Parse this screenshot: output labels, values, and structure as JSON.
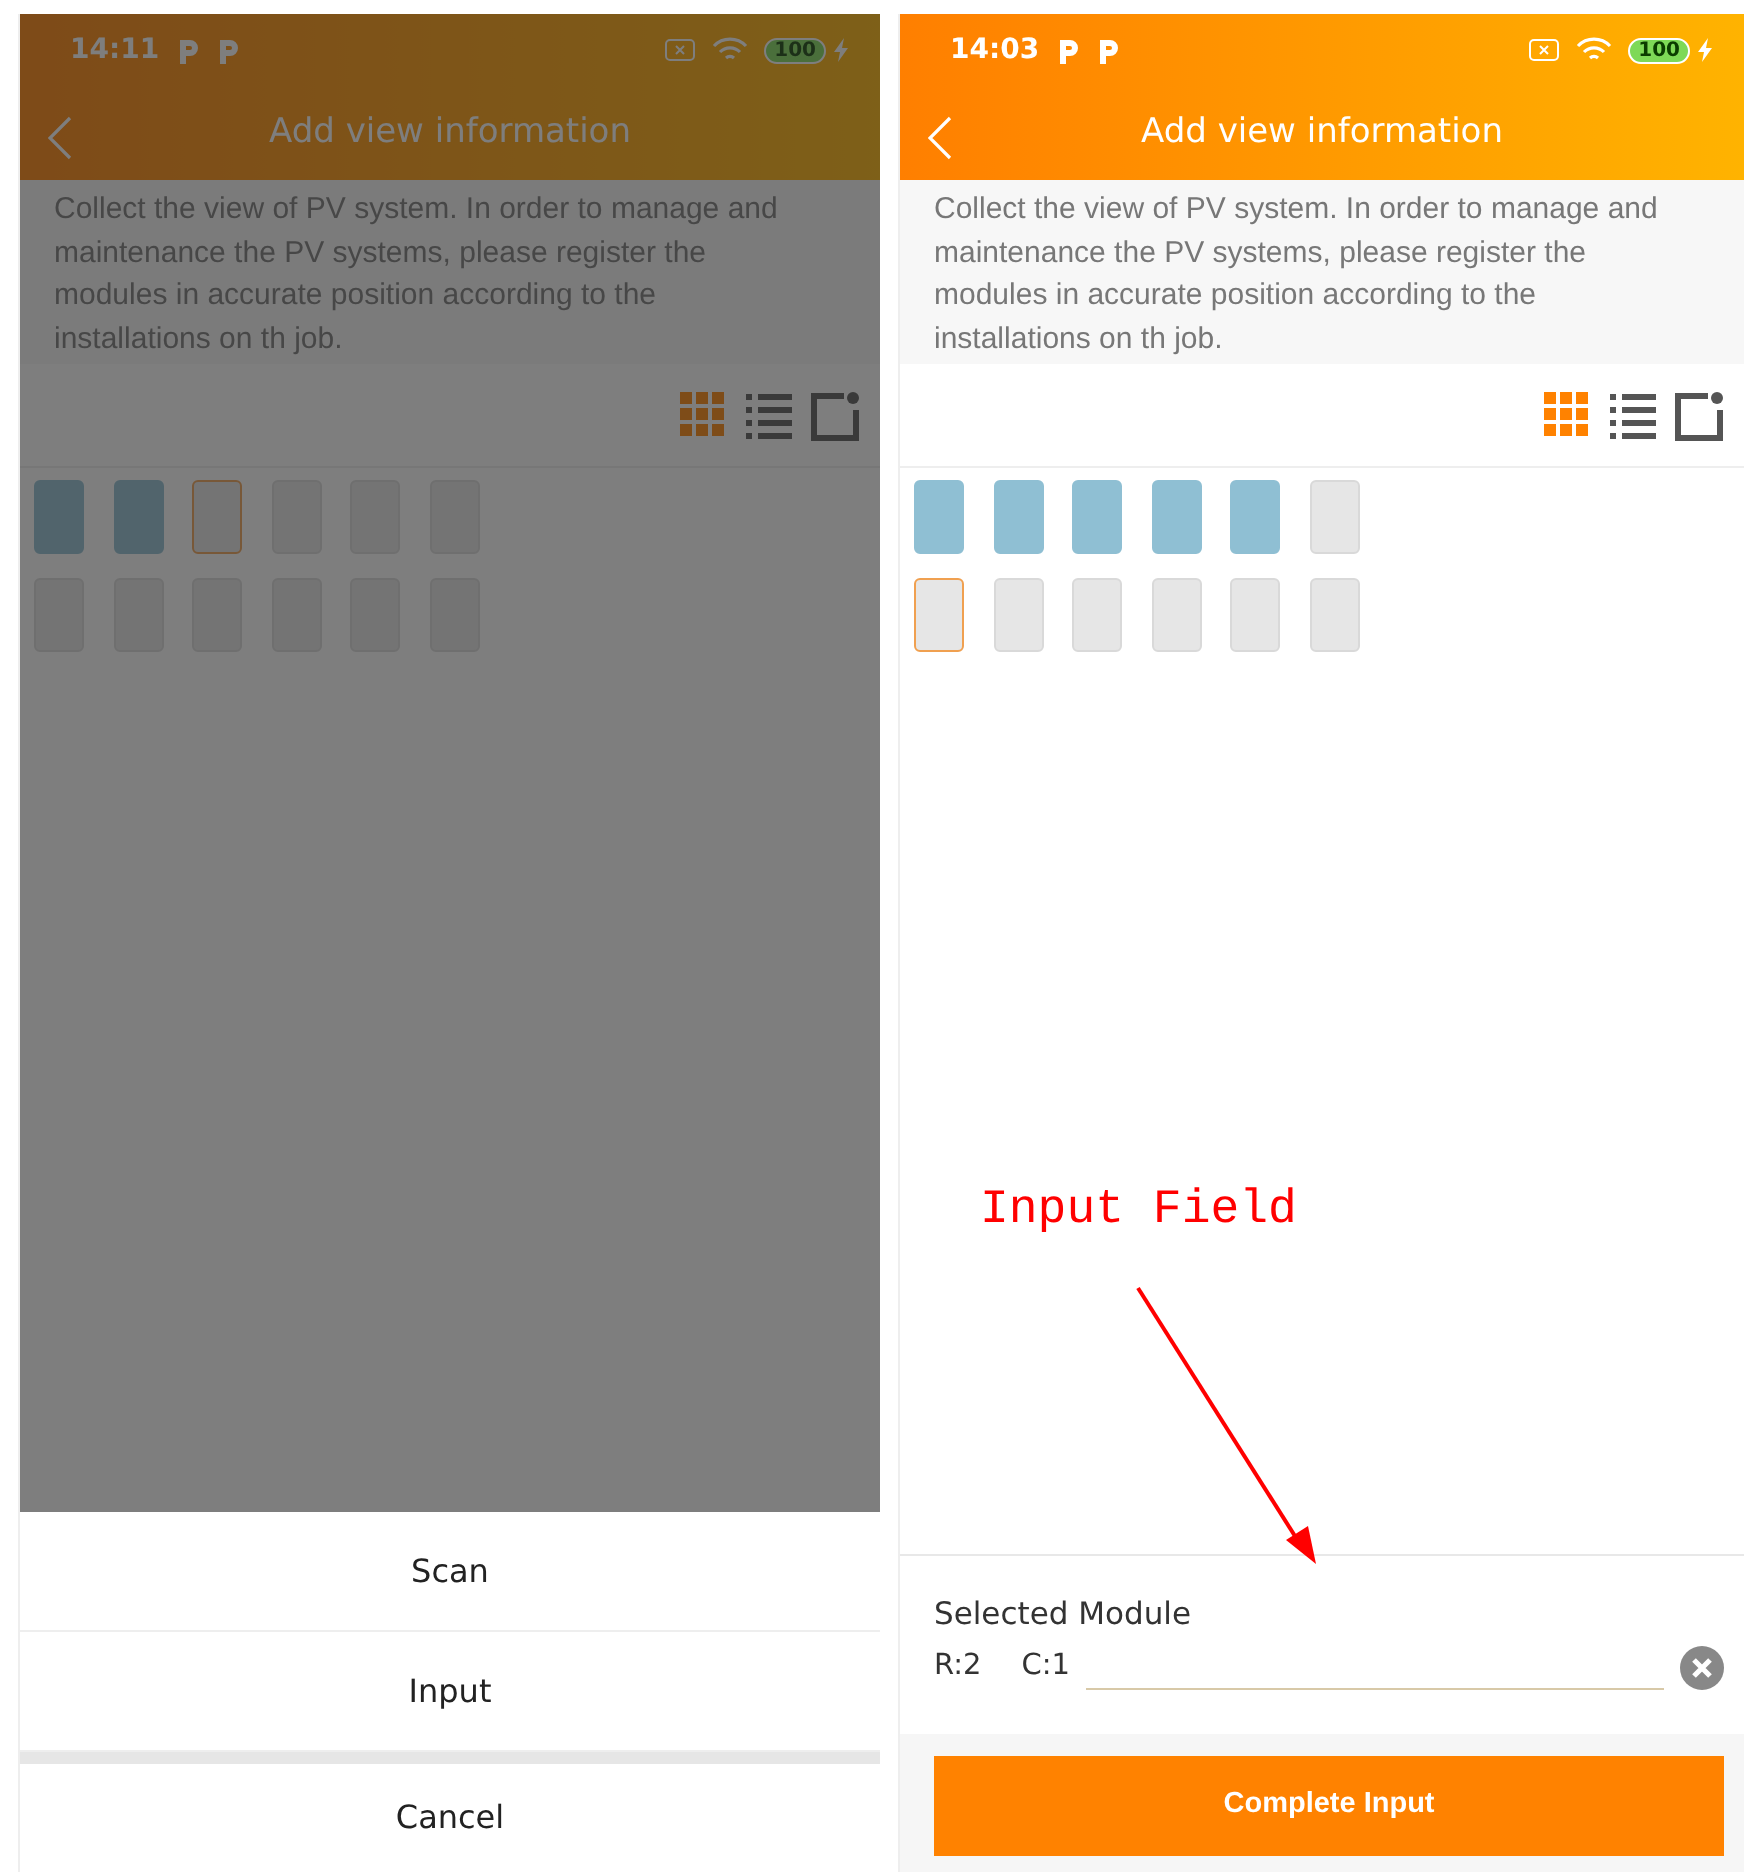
{
  "phones": [
    {
      "dimmed": true,
      "status_bar": {
        "time": "14:11",
        "battery": "100"
      },
      "title": "Add view information",
      "description": "Collect the view of PV system. In order to manage and maintenance the PV systems, please register the modules in accurate position according to the installations on th job.",
      "view_modes": [
        {
          "kind": "grid",
          "selected": true
        },
        {
          "kind": "list",
          "selected": false
        },
        {
          "kind": "photo",
          "selected": false
        }
      ],
      "module_rows": [
        [
          {
            "filled": true,
            "selected": false
          },
          {
            "filled": true,
            "selected": false
          },
          {
            "filled": false,
            "selected": true
          },
          {
            "filled": false,
            "selected": false
          },
          {
            "filled": false,
            "selected": false
          },
          {
            "filled": false,
            "selected": false
          }
        ],
        [
          {
            "filled": false,
            "selected": false
          },
          {
            "filled": false,
            "selected": false
          },
          {
            "filled": false,
            "selected": false
          },
          {
            "filled": false,
            "selected": false
          },
          {
            "filled": false,
            "selected": false
          },
          {
            "filled": false,
            "selected": false
          }
        ]
      ],
      "action_sheet": {
        "items": [
          "Scan",
          "Input"
        ],
        "cancel": "Cancel"
      }
    },
    {
      "dimmed": false,
      "status_bar": {
        "time": "14:03",
        "battery": "100"
      },
      "title": "Add view information",
      "description": "Collect the view of PV system. In order to manage and maintenance the PV systems, please register the modules in accurate position according to the installations on th job.",
      "view_modes": [
        {
          "kind": "grid",
          "selected": true
        },
        {
          "kind": "list",
          "selected": false
        },
        {
          "kind": "photo",
          "selected": false
        }
      ],
      "module_rows": [
        [
          {
            "filled": true,
            "selected": false
          },
          {
            "filled": true,
            "selected": false
          },
          {
            "filled": true,
            "selected": false
          },
          {
            "filled": true,
            "selected": false
          },
          {
            "filled": true,
            "selected": false
          },
          {
            "filled": false,
            "selected": false
          }
        ],
        [
          {
            "filled": false,
            "selected": true
          },
          {
            "filled": false,
            "selected": false
          },
          {
            "filled": false,
            "selected": false
          },
          {
            "filled": false,
            "selected": false
          },
          {
            "filled": false,
            "selected": false
          },
          {
            "filled": false,
            "selected": false
          }
        ]
      ],
      "selected_module": {
        "heading": "Selected Module",
        "row": "R:2",
        "column": "C:1"
      },
      "complete_button": "Complete Input"
    }
  ],
  "annotation": {
    "text": "Input Field"
  }
}
